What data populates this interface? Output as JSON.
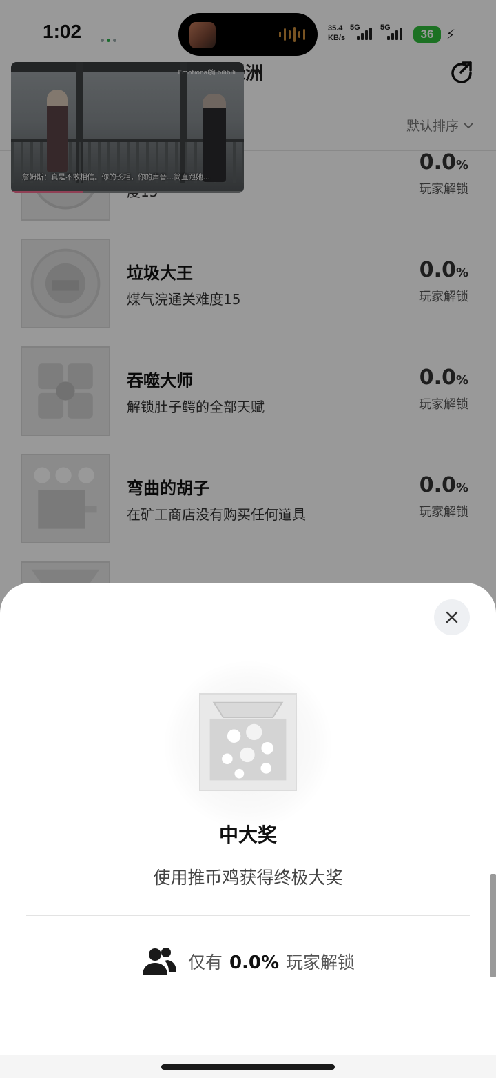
{
  "status_bar": {
    "time": "1:02",
    "net_speed_value": "35.4",
    "net_speed_unit": "KB/s",
    "signal_1": "5G",
    "signal_2": "5G",
    "battery": "36"
  },
  "header": {
    "title_partial": "绿洲",
    "sort_label": "默认排序"
  },
  "pip": {
    "watermark": "Emotional狗 bilibili",
    "subtitle": "詹姆斯：真是不敢相信。你的长相，你的声音…简直跟她…",
    "progress": 0.31
  },
  "achievements": [
    {
      "title": "",
      "desc_partial": "度15",
      "percent": "0.0",
      "percent_unit": "%",
      "unlock_label": "玩家解锁"
    },
    {
      "title": "垃圾大王",
      "desc": "煤气浣通关难度15",
      "percent": "0.0",
      "percent_unit": "%",
      "unlock_label": "玩家解锁"
    },
    {
      "title": "吞噬大师",
      "desc": "解锁肚子鳄的全部天赋",
      "percent": "0.0",
      "percent_unit": "%",
      "unlock_label": "玩家解锁"
    },
    {
      "title": "弯曲的胡子",
      "desc": "在矿工商店没有购买任何道具",
      "percent": "0.0",
      "percent_unit": "%",
      "unlock_label": "玩家解锁"
    }
  ],
  "sheet": {
    "title": "中大奖",
    "description": "使用推币鸡获得终极大奖",
    "stat_prefix": "仅有",
    "stat_value": "0.0%",
    "stat_suffix": "玩家解锁"
  },
  "icons": {
    "share": "share-icon",
    "sort": "chevron-down-icon",
    "close": "close-icon",
    "players": "users-icon"
  },
  "colors": {
    "battery": "#2fbd3b",
    "pip_progress": "#f06b8e",
    "overlay": "rgba(0,0,0,0.40)"
  }
}
